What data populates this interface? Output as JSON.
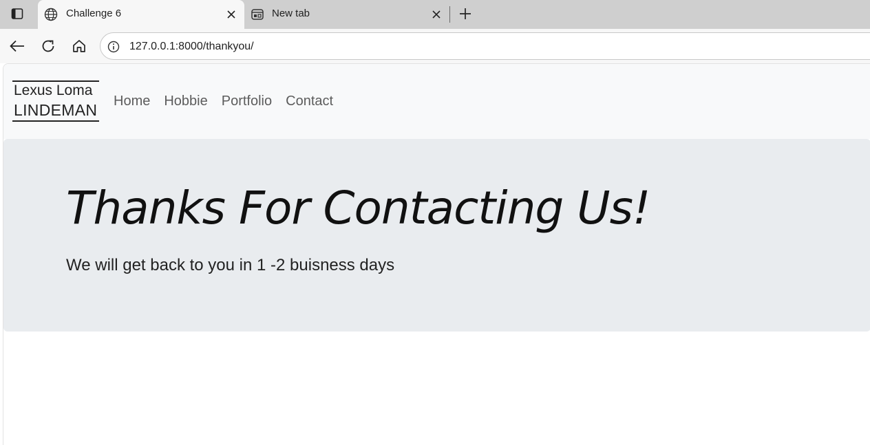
{
  "browser": {
    "tabs": [
      {
        "title": "Challenge 6",
        "icon": "globe-icon",
        "active": true
      },
      {
        "title": "New tab",
        "icon": "new-tab-page-icon",
        "active": false
      }
    ],
    "url": "127.0.0.1:8000/thankyou/"
  },
  "page": {
    "brand": {
      "line1": "Lexus Loma",
      "line2": "LINDEMAN"
    },
    "nav": [
      "Home",
      "Hobbie",
      "Portfolio",
      "Contact"
    ],
    "heading": "Thanks For Contacting Us!",
    "lead": "We will get back to you in 1 -2 buisness days"
  },
  "colors": {
    "navbar_bg": "#f8f9fa",
    "jumbotron_bg": "#e9ecef",
    "nav_link": "#5c5c5c"
  }
}
